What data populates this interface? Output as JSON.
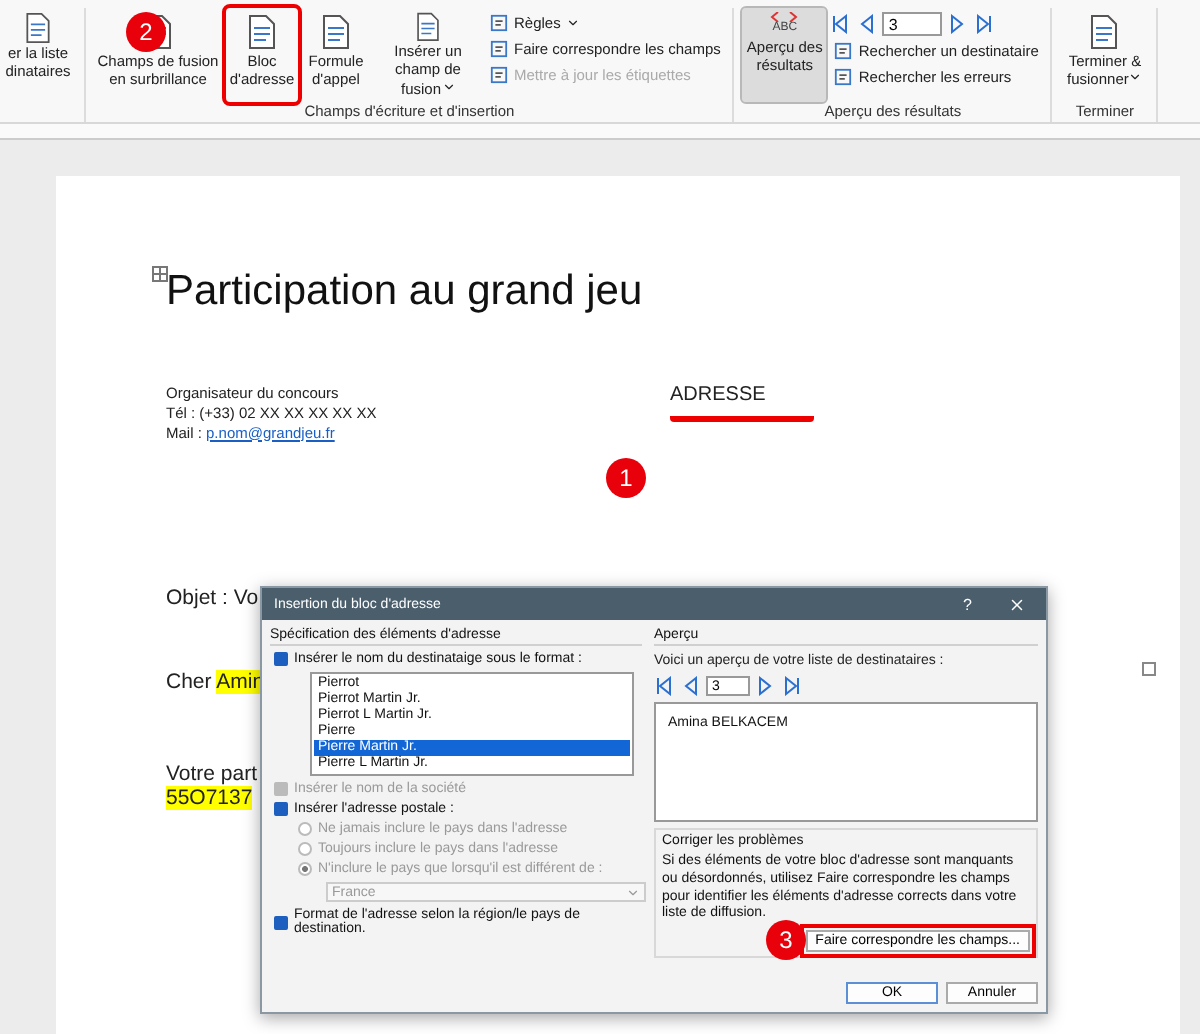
{
  "ribbon": {
    "cut_button": {
      "lines": [
        "er la liste",
        "dinataires"
      ]
    },
    "groups": [
      {
        "label": "Champs d'écriture et d'insertion",
        "items": [
          {
            "kind": "big",
            "label": "Champs de fusion en surbrillance",
            "caret": false,
            "framed": false
          },
          {
            "kind": "big",
            "label": "Bloc d'adresse",
            "caret": false,
            "framed": true
          },
          {
            "kind": "big",
            "label": "Formule d'appel",
            "caret": false,
            "framed": false
          },
          {
            "kind": "big",
            "label": "Insérer un champ de fusion",
            "caret": true,
            "framed": false
          },
          {
            "kind": "stack",
            "entries": [
              {
                "label": "Règles",
                "caret": true,
                "disabled": false
              },
              {
                "label": "Faire correspondre les champs",
                "caret": false,
                "disabled": false
              },
              {
                "label": "Mettre à jour les étiquettes",
                "caret": false,
                "disabled": true
              }
            ]
          }
        ]
      },
      {
        "label": "Aperçu des résultats",
        "items": [
          {
            "kind": "toggle",
            "label": "Aperçu des résultats",
            "badge": "ABC",
            "selected": true
          },
          {
            "kind": "nav",
            "value": "3",
            "entries": [
              {
                "label": "Rechercher un destinataire",
                "caret": false,
                "disabled": false
              },
              {
                "label": "Rechercher les erreurs",
                "caret": false,
                "disabled": false
              }
            ]
          }
        ]
      },
      {
        "label": "Terminer",
        "items": [
          {
            "kind": "big",
            "label": "Terminer & fusionner",
            "caret": true,
            "framed": false
          }
        ]
      }
    ]
  },
  "document": {
    "title": "Participation au grand jeu",
    "sender": [
      {
        "text": "Organisateur du concours"
      },
      {
        "text": "Tél : (+33) 02 XX XX XX XX XX"
      },
      {
        "text": "Mail : ",
        "link_text": "p.nom@grandjeu.fr"
      }
    ],
    "address_field": "ADRESSE",
    "lines": [
      {
        "text": "Objet : Vo"
      },
      {
        "text": "Cher ",
        "highlight": "Amin"
      },
      {
        "text": "Votre part"
      },
      {
        "highlight": "55O7137"
      }
    ]
  },
  "dialog": {
    "title": "Insertion du bloc d'adresse",
    "help": "?",
    "left": {
      "heading": "Spécification des éléments d'adresse",
      "name_option": {
        "label": "Insérer le nom du destinataige sous le format :",
        "checked": true,
        "disabled": false
      },
      "formats": [
        {
          "label": "Pierrot",
          "selected": false
        },
        {
          "label": "Pierrot Martin Jr.",
          "selected": false
        },
        {
          "label": "Pierrot L Martin Jr.",
          "selected": false
        },
        {
          "label": "Pierre",
          "selected": false
        },
        {
          "label": "Pierre Martin Jr.",
          "selected": true
        },
        {
          "label": "Pierre L Martin Jr.",
          "selected": false
        }
      ],
      "company_option": {
        "label": "Insérer le nom de la société",
        "checked": true,
        "disabled": true
      },
      "postal_option": {
        "label": "Insérer l'adresse postale :",
        "checked": true,
        "disabled": false
      },
      "country_radios": [
        {
          "label": "Ne jamais inclure le pays dans l'adresse",
          "selected": false
        },
        {
          "label": "Toujours inclure le pays dans l'adresse",
          "selected": false
        },
        {
          "label": "N'inclure le pays que lorsqu'il est différent de :",
          "selected": true
        }
      ],
      "country": "France",
      "format_option": {
        "label": "Format de l'adresse selon la région/le pays de destination.",
        "checked": true,
        "disabled": false
      }
    },
    "right": {
      "heading": "Aperçu",
      "intro": "Voici un aperçu de votre liste de destinataires :",
      "record": "3",
      "preview": "Amina BELKACEM",
      "fix_heading": "Corriger les problèmes",
      "fix_text": "Si des éléments de votre bloc d'adresse sont manquants ou désordonnés, utilisez Faire correspondre les champs pour identifier les éléments d'adresse corrects dans votre liste de diffusion.",
      "fix_button": "Faire correspondre les champs..."
    },
    "buttons": [
      {
        "label": "OK",
        "kind": "primary"
      },
      {
        "label": "Annuler",
        "kind": "secondary"
      }
    ]
  },
  "callouts": [
    {
      "number": "1"
    },
    {
      "number": "2"
    },
    {
      "number": "3"
    }
  ]
}
